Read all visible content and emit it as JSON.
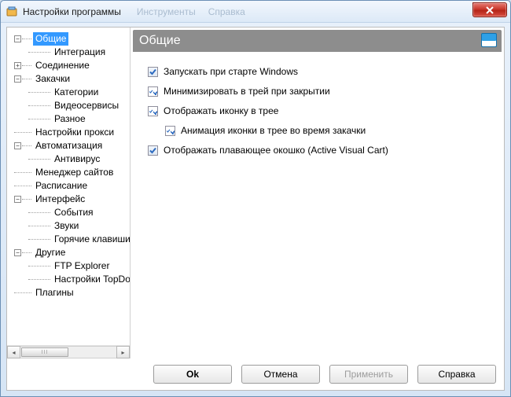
{
  "window": {
    "title": "Настройки программы",
    "ghost_menu": [
      "Инструменты",
      "Справка"
    ]
  },
  "tree": {
    "items": [
      {
        "label": "Общие",
        "level": 0,
        "expander": "minus",
        "selected": true
      },
      {
        "label": "Интеграция",
        "level": 1,
        "expander": "none"
      },
      {
        "label": "Соединение",
        "level": 0,
        "expander": "plus"
      },
      {
        "label": "Закачки",
        "level": 0,
        "expander": "minus"
      },
      {
        "label": "Категории",
        "level": 1,
        "expander": "none"
      },
      {
        "label": "Видеосервисы",
        "level": 1,
        "expander": "none"
      },
      {
        "label": "Разное",
        "level": 1,
        "expander": "none"
      },
      {
        "label": "Настройки прокси",
        "level": 0,
        "expander": "none-root"
      },
      {
        "label": "Автоматизация",
        "level": 0,
        "expander": "minus"
      },
      {
        "label": "Антивирус",
        "level": 1,
        "expander": "none"
      },
      {
        "label": "Менеджер сайтов",
        "level": 0,
        "expander": "none-root"
      },
      {
        "label": "Расписание",
        "level": 0,
        "expander": "none-root"
      },
      {
        "label": "Интерфейс",
        "level": 0,
        "expander": "minus"
      },
      {
        "label": "События",
        "level": 1,
        "expander": "none"
      },
      {
        "label": "Звуки",
        "level": 1,
        "expander": "none"
      },
      {
        "label": "Горячие клавиши",
        "level": 1,
        "expander": "none"
      },
      {
        "label": "Другие",
        "level": 0,
        "expander": "minus"
      },
      {
        "label": "FTP Explorer",
        "level": 1,
        "expander": "none"
      },
      {
        "label": "Настройки TopDownloads",
        "level": 1,
        "expander": "none"
      },
      {
        "label": "Плагины",
        "level": 0,
        "expander": "none-root"
      }
    ]
  },
  "section": {
    "title": "Общие",
    "options": [
      {
        "label": "Запускать при старте Windows",
        "checked": false,
        "indent": false
      },
      {
        "label": "Минимизировать в трей при закрытии",
        "checked": true,
        "indent": false
      },
      {
        "label": "Отображать иконку в трее",
        "checked": true,
        "indent": false
      },
      {
        "label": "Анимация иконки в трее во время закачки",
        "checked": true,
        "indent": true
      },
      {
        "label": "Отображать плавающее окошко (Active Visual Cart)",
        "checked": false,
        "indent": false
      }
    ]
  },
  "buttons": {
    "ok": "Ok",
    "cancel": "Отмена",
    "apply": "Применить",
    "help": "Справка"
  }
}
